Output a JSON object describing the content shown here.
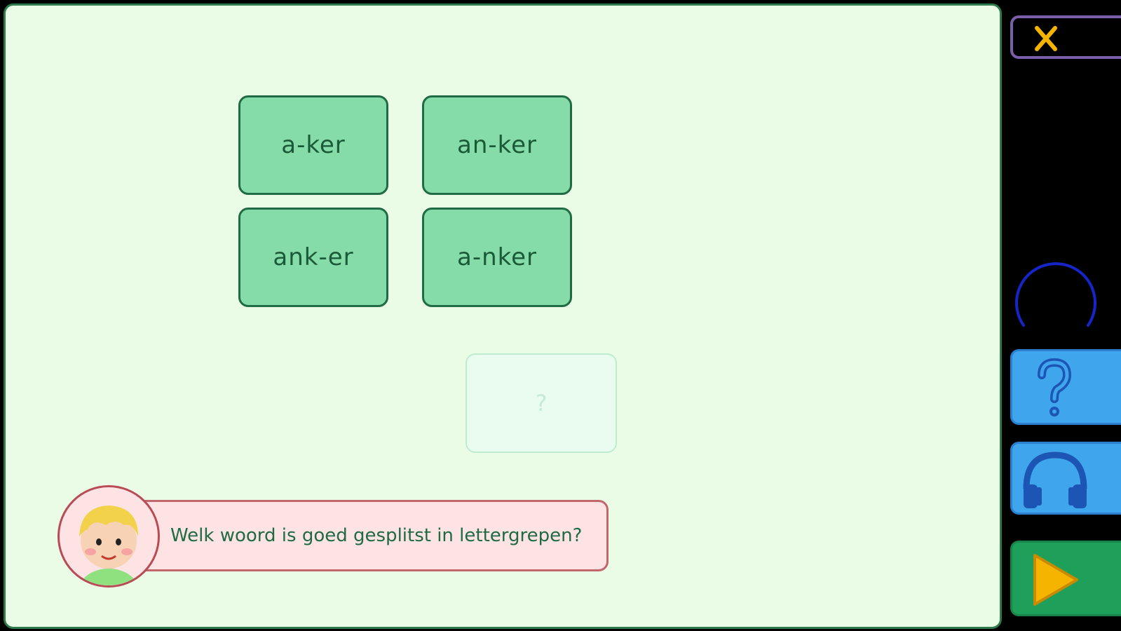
{
  "exercise": {
    "options": [
      {
        "label": "a-ker"
      },
      {
        "label": "an-ker"
      },
      {
        "label": "ank-er"
      },
      {
        "label": "a-nker"
      }
    ],
    "drop_slot": {
      "placeholder": "?"
    },
    "question": "Welk woord is goed gesplitst in lettergrepen?"
  },
  "sidebar": {
    "close_icon": "close-icon",
    "help_icon": "question-mark-icon",
    "audio_icon": "headphones-icon",
    "next_icon": "play-icon",
    "loading_icon": "loading-spinner-icon"
  },
  "colors": {
    "panel_bg": "#eafbe6",
    "option_bg": "#86dca9",
    "option_border": "#1f6b43",
    "speech_bg": "#fde3e3",
    "help_blue": "#3fa6ee",
    "next_green": "#1fa05a",
    "accent_yellow": "#f5b400"
  }
}
